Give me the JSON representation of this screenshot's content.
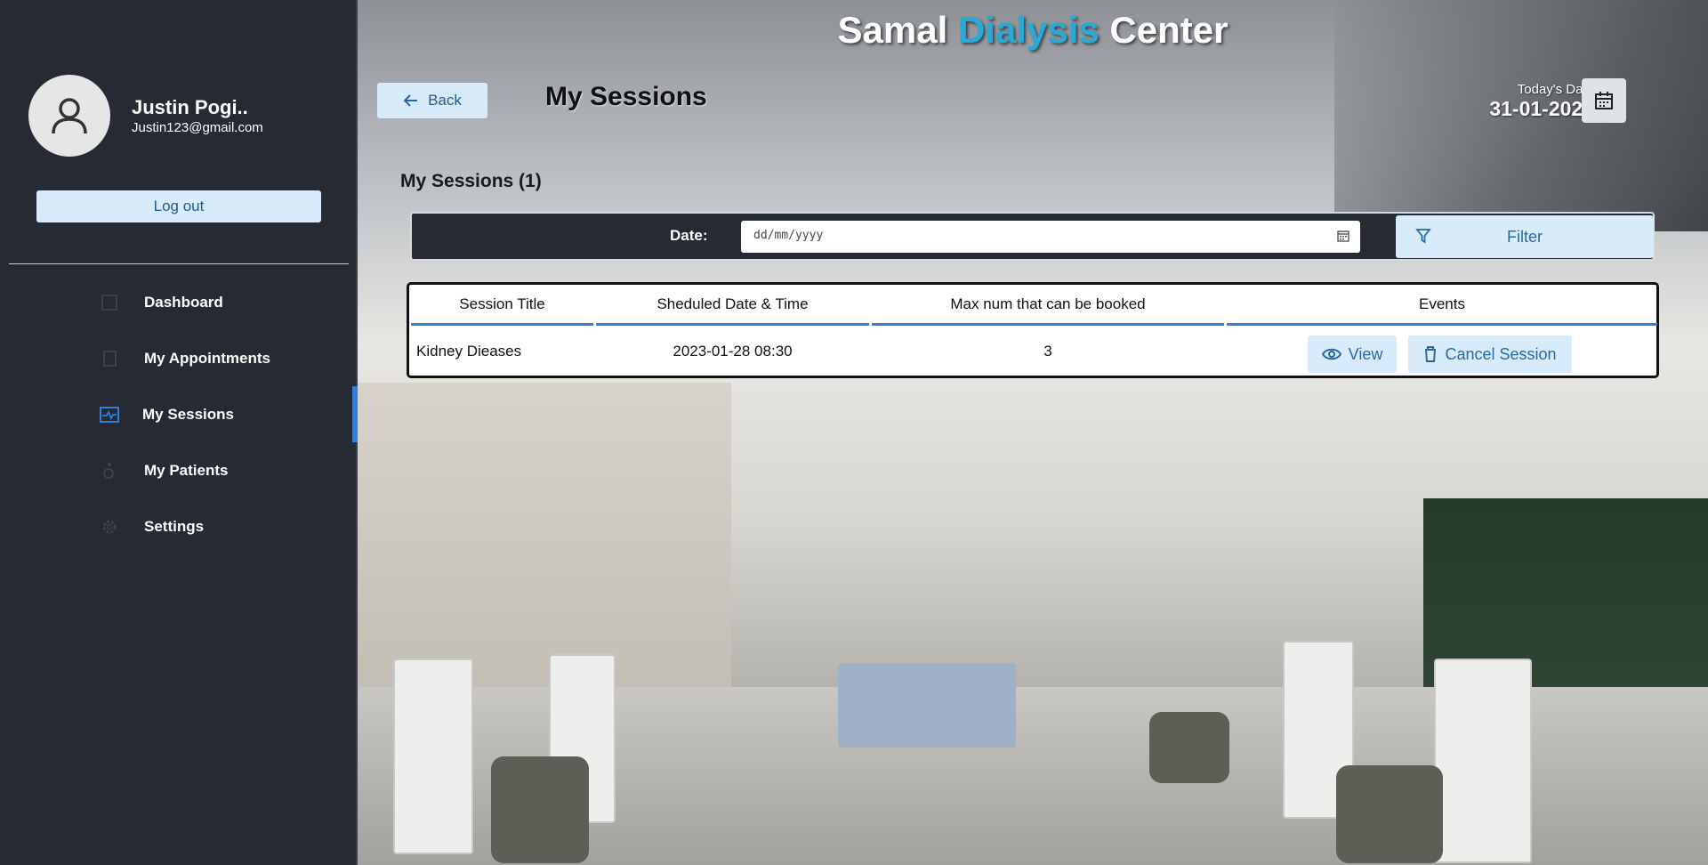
{
  "header": {
    "title_part1": "Samal",
    "title_accent": "Dialysis",
    "title_part2": "Center",
    "page_title": "My Sessions",
    "back_label": "Back",
    "today_label": "Today's Date",
    "today_value": "31-01-2023"
  },
  "profile": {
    "name": "Justin Pogi..",
    "email": "Justin123@gmail.com",
    "logout_label": "Log out"
  },
  "sidebar": {
    "items": [
      {
        "label": "Dashboard",
        "icon": "dashboard-icon",
        "active": false
      },
      {
        "label": "My Appointments",
        "icon": "book-icon",
        "active": false
      },
      {
        "label": "My Sessions",
        "icon": "session-icon",
        "active": true
      },
      {
        "label": "My Patients",
        "icon": "wheelchair-icon",
        "active": false
      },
      {
        "label": "Settings",
        "icon": "gear-icon",
        "active": false
      }
    ]
  },
  "sessions": {
    "heading": "My Sessions (1)",
    "filter": {
      "date_label": "Date:",
      "date_placeholder": "dd/mm/yyyy",
      "filter_label": "Filter"
    },
    "columns": [
      "Session Title",
      "Sheduled Date & Time",
      "Max num that can be booked",
      "Events"
    ],
    "rows": [
      {
        "title": "Kidney Dieases",
        "datetime": "2023-01-28 08:30",
        "max": "3",
        "view_label": "View",
        "cancel_label": "Cancel Session"
      }
    ]
  },
  "colors": {
    "sidebar_bg": "#262a33",
    "accent": "#29a9d8",
    "button_bg": "#d8ebfb",
    "button_text": "#2a6aa4",
    "active_indicator": "#2f80d6"
  }
}
